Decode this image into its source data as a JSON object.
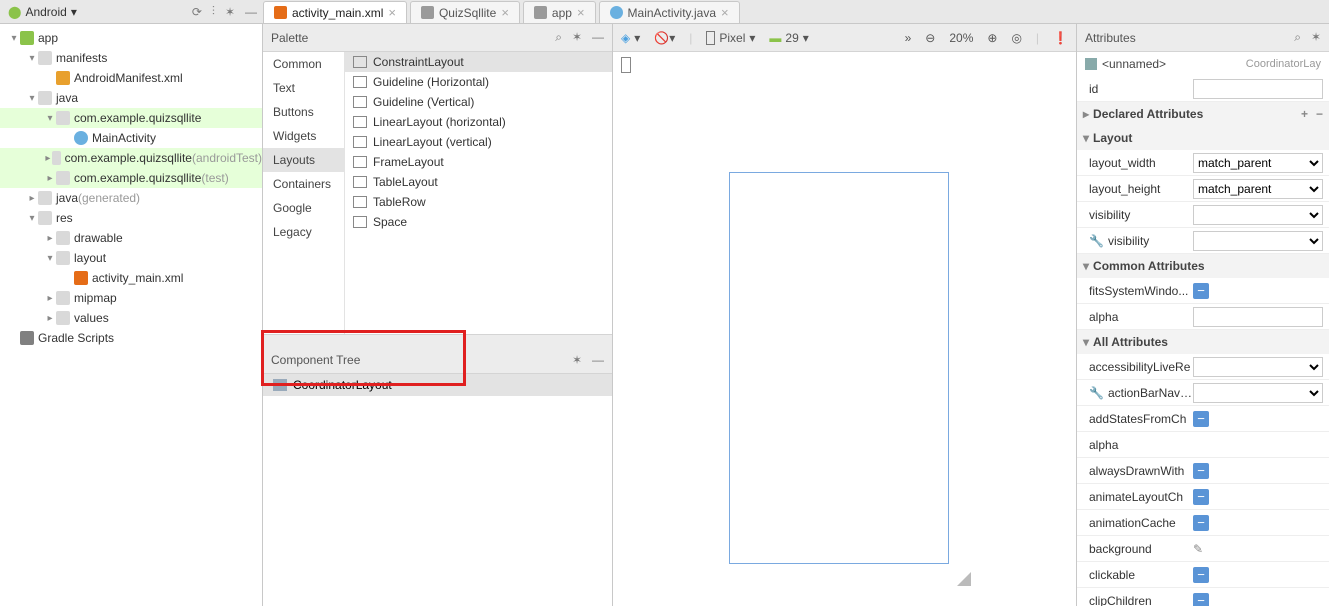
{
  "topbar": {
    "module_dropdown": "Android",
    "tabs": [
      {
        "label": "activity_main.xml",
        "icon": "xml",
        "active": true
      },
      {
        "label": "QuizSqllite",
        "icon": "grey",
        "active": false
      },
      {
        "label": "app",
        "icon": "grey",
        "active": false
      },
      {
        "label": "MainActivity.java",
        "icon": "c",
        "active": false
      }
    ]
  },
  "project_tree": {
    "nodes": [
      {
        "depth": 0,
        "label": "app",
        "icon": "and",
        "arrow": "▾"
      },
      {
        "depth": 1,
        "label": "manifests",
        "icon": "folder",
        "arrow": "▾"
      },
      {
        "depth": 2,
        "label": "AndroidManifest.xml",
        "icon": "mf",
        "arrow": ""
      },
      {
        "depth": 1,
        "label": "java",
        "icon": "folder",
        "arrow": "▾"
      },
      {
        "depth": 2,
        "label": "com.example.quizsqllite",
        "icon": "folder",
        "arrow": "▾",
        "hl": true
      },
      {
        "depth": 3,
        "label": "MainActivity",
        "icon": "cir",
        "arrow": ""
      },
      {
        "depth": 2,
        "label": "com.example.quizsqllite",
        "suffix": "(androidTest)",
        "icon": "folder",
        "arrow": "▸",
        "hl": true
      },
      {
        "depth": 2,
        "label": "com.example.quizsqllite",
        "suffix": "(test)",
        "icon": "folder",
        "arrow": "▸",
        "hl": true
      },
      {
        "depth": 1,
        "label": "java",
        "suffix": "(generated)",
        "icon": "folder",
        "arrow": "▸"
      },
      {
        "depth": 1,
        "label": "res",
        "icon": "folder",
        "arrow": "▾"
      },
      {
        "depth": 2,
        "label": "drawable",
        "icon": "folder",
        "arrow": "▸"
      },
      {
        "depth": 2,
        "label": "layout",
        "icon": "folder",
        "arrow": "▾"
      },
      {
        "depth": 3,
        "label": "activity_main.xml",
        "icon": "xmlf",
        "arrow": ""
      },
      {
        "depth": 2,
        "label": "mipmap",
        "icon": "folder",
        "arrow": "▸"
      },
      {
        "depth": 2,
        "label": "values",
        "icon": "folder",
        "arrow": "▸"
      },
      {
        "depth": 0,
        "label": "Gradle Scripts",
        "icon": "gradle",
        "arrow": ""
      }
    ]
  },
  "palette": {
    "title": "Palette",
    "categories": [
      "Common",
      "Text",
      "Buttons",
      "Widgets",
      "Layouts",
      "Containers",
      "Google",
      "Legacy"
    ],
    "selected_category": "Layouts",
    "items": [
      "ConstraintLayout",
      "Guideline (Horizontal)",
      "Guideline (Vertical)",
      "LinearLayout (horizontal)",
      "LinearLayout (vertical)",
      "FrameLayout",
      "TableLayout",
      "TableRow",
      "Space"
    ],
    "selected_item": "ConstraintLayout"
  },
  "component_tree": {
    "title": "Component Tree",
    "root": "CoordinatorLayout"
  },
  "design_toolbar": {
    "device": "Pixel",
    "api": "29",
    "zoom": "20%"
  },
  "attributes": {
    "title": "Attributes",
    "element_name": "<unnamed>",
    "element_type": "CoordinatorLay",
    "id_label": "id",
    "id_value": "",
    "sections": {
      "declared": "Declared Attributes",
      "layout": "Layout",
      "common": "Common Attributes",
      "all": "All Attributes"
    },
    "layout": {
      "width_label": "layout_width",
      "width_value": "match_parent",
      "height_label": "layout_height",
      "height_value": "match_parent",
      "visibility_label": "visibility",
      "visibility_value": "",
      "visibility2_label": "visibility",
      "visibility2_value": ""
    },
    "common": {
      "fits_label": "fitsSystemWindo...",
      "alpha_label": "alpha",
      "alpha_value": ""
    },
    "all": [
      {
        "k": "accessibilityLiveRe",
        "t": "select"
      },
      {
        "k": "actionBarNavMod",
        "t": "select",
        "wrench": true
      },
      {
        "k": "addStatesFromCh",
        "t": "check"
      },
      {
        "k": "alpha",
        "t": "blank"
      },
      {
        "k": "alwaysDrawnWith",
        "t": "check"
      },
      {
        "k": "animateLayoutCh",
        "t": "check"
      },
      {
        "k": "animationCache",
        "t": "check"
      },
      {
        "k": "background",
        "t": "picker"
      },
      {
        "k": "clickable",
        "t": "check"
      },
      {
        "k": "clipChildren",
        "t": "check"
      }
    ]
  }
}
